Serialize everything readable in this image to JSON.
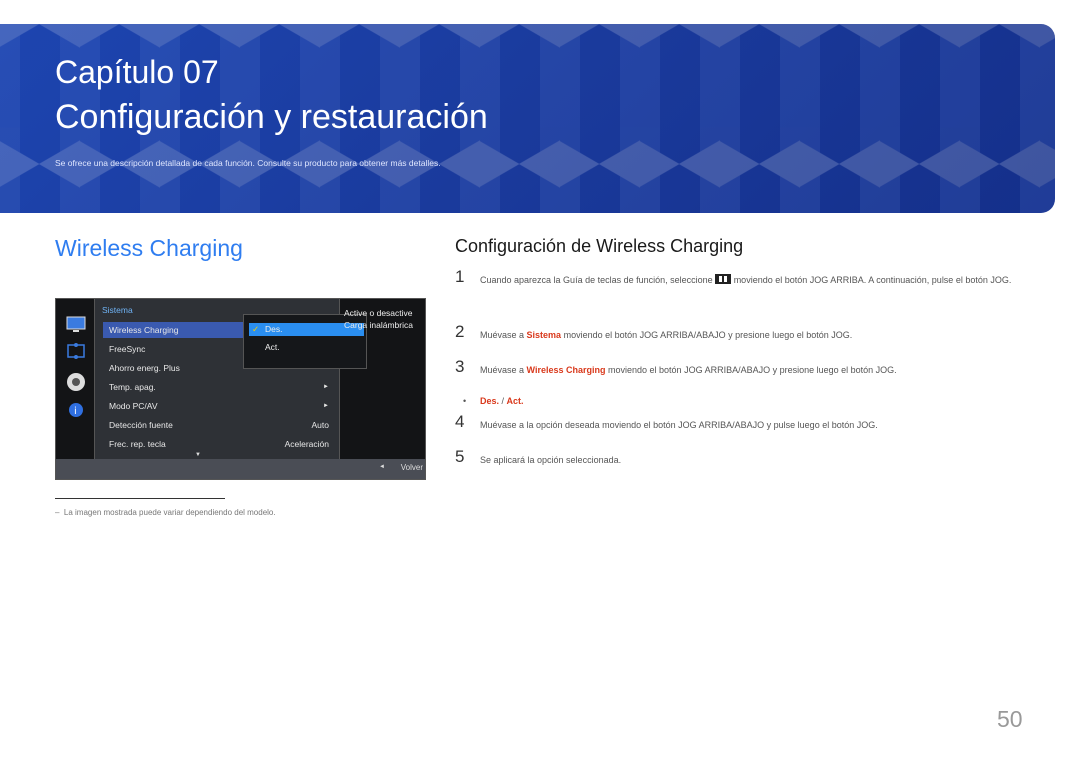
{
  "header": {
    "chapter": "Capítulo 07",
    "title": "Configuración y restauración",
    "subtitle": "Se ofrece una descripción detallada de cada función. Consulte su producto para obtener más detalles."
  },
  "left": {
    "heading": "Wireless Charging",
    "osd": {
      "menu_title": "Sistema",
      "items": [
        {
          "label": "Wireless Charging",
          "value": ""
        },
        {
          "label": "FreeSync",
          "value": ""
        },
        {
          "label": "Ahorro energ. Plus",
          "value": ""
        },
        {
          "label": "Temp. apag.",
          "value": "►"
        },
        {
          "label": "Modo PC/AV",
          "value": "►"
        },
        {
          "label": "Detección fuente",
          "value": "Auto"
        },
        {
          "label": "Frec. rep. tecla",
          "value": "Aceleración"
        }
      ],
      "options": [
        "Des.",
        "Act."
      ],
      "help": "Active o desactive Carga inalámbrica",
      "back": "Volver",
      "sidebar_icons": [
        "monitor-icon",
        "resize-icon",
        "gear-icon",
        "info-icon"
      ]
    },
    "note": "La imagen mostrada puede variar dependiendo del modelo."
  },
  "right": {
    "heading": "Configuración de Wireless Charging",
    "steps": [
      {
        "n": "1",
        "pre": "Cuando aparezca la Guía de teclas de función, seleccione",
        "post": "moviendo el botón JOG ARRIBA. A continuación, pulse el botón JOG."
      },
      {
        "n": "2",
        "pre": "Muévase a",
        "hl": "Sistema",
        "post": "moviendo el botón JOG ARRIBA/ABAJO y presione luego el botón JOG."
      },
      {
        "n": "3",
        "pre": "Muévase a",
        "hl": "Wireless Charging",
        "post": "moviendo el botón JOG ARRIBA/ABAJO y presione luego el botón JOG."
      },
      {
        "n": "4",
        "text": "Muévase a la opción deseada moviendo el botón JOG ARRIBA/ABAJO y pulse luego el botón JOG."
      },
      {
        "n": "5",
        "text": "Se aplicará la opción seleccionada."
      }
    ],
    "bullet": {
      "a": "Des.",
      "sep": " / ",
      "b": "Act."
    }
  },
  "page_number": "50",
  "colors": {
    "banner": "#1a3a9c",
    "heading_blue": "#2f7df0",
    "highlight_red": "#d9391c"
  }
}
